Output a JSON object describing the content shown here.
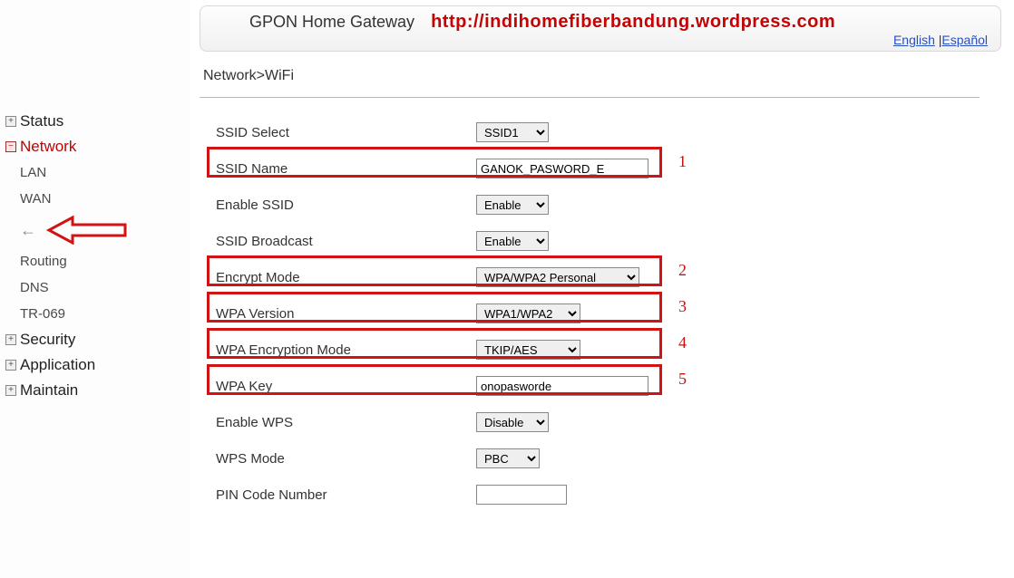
{
  "header": {
    "title": "GPON Home Gateway",
    "banner_url": "http://indihomefiberbandung.wordpress.com",
    "lang_en": "English",
    "lang_sep": " |",
    "lang_es": "Español"
  },
  "breadcrumb": "Network>WiFi",
  "sidebar": {
    "items": [
      {
        "label": "Status",
        "type": "top",
        "icon": "plus"
      },
      {
        "label": "Network",
        "type": "top",
        "icon": "minus",
        "active": true
      },
      {
        "label": "LAN",
        "type": "sub"
      },
      {
        "label": "WAN",
        "type": "sub"
      },
      {
        "label": "",
        "type": "back"
      },
      {
        "label": "Routing",
        "type": "sub"
      },
      {
        "label": "DNS",
        "type": "sub"
      },
      {
        "label": "TR-069",
        "type": "sub"
      },
      {
        "label": "Security",
        "type": "top",
        "icon": "plus"
      },
      {
        "label": "Application",
        "type": "top",
        "icon": "plus"
      },
      {
        "label": "Maintain",
        "type": "top",
        "icon": "plus"
      }
    ]
  },
  "form": {
    "ssid_select": {
      "label": "SSID Select",
      "value": "SSID1"
    },
    "ssid_name": {
      "label": "SSID Name",
      "value": "GANOK_PASWORD_E"
    },
    "enable_ssid": {
      "label": "Enable SSID",
      "value": "Enable"
    },
    "ssid_broadcast": {
      "label": "SSID Broadcast",
      "value": "Enable"
    },
    "encrypt_mode": {
      "label": "Encrypt Mode",
      "value": "WPA/WPA2 Personal"
    },
    "wpa_version": {
      "label": "WPA Version",
      "value": "WPA1/WPA2"
    },
    "wpa_enc_mode": {
      "label": "WPA Encryption Mode",
      "value": "TKIP/AES"
    },
    "wpa_key": {
      "label": "WPA Key",
      "value": "onopasworde"
    },
    "enable_wps": {
      "label": "Enable WPS",
      "value": "Disable"
    },
    "wps_mode": {
      "label": "WPS Mode",
      "value": "PBC"
    },
    "pin_code": {
      "label": "PIN Code Number",
      "value": ""
    }
  },
  "annotations": {
    "n1": "1",
    "n2": "2",
    "n3": "3",
    "n4": "4",
    "n5": "5"
  }
}
